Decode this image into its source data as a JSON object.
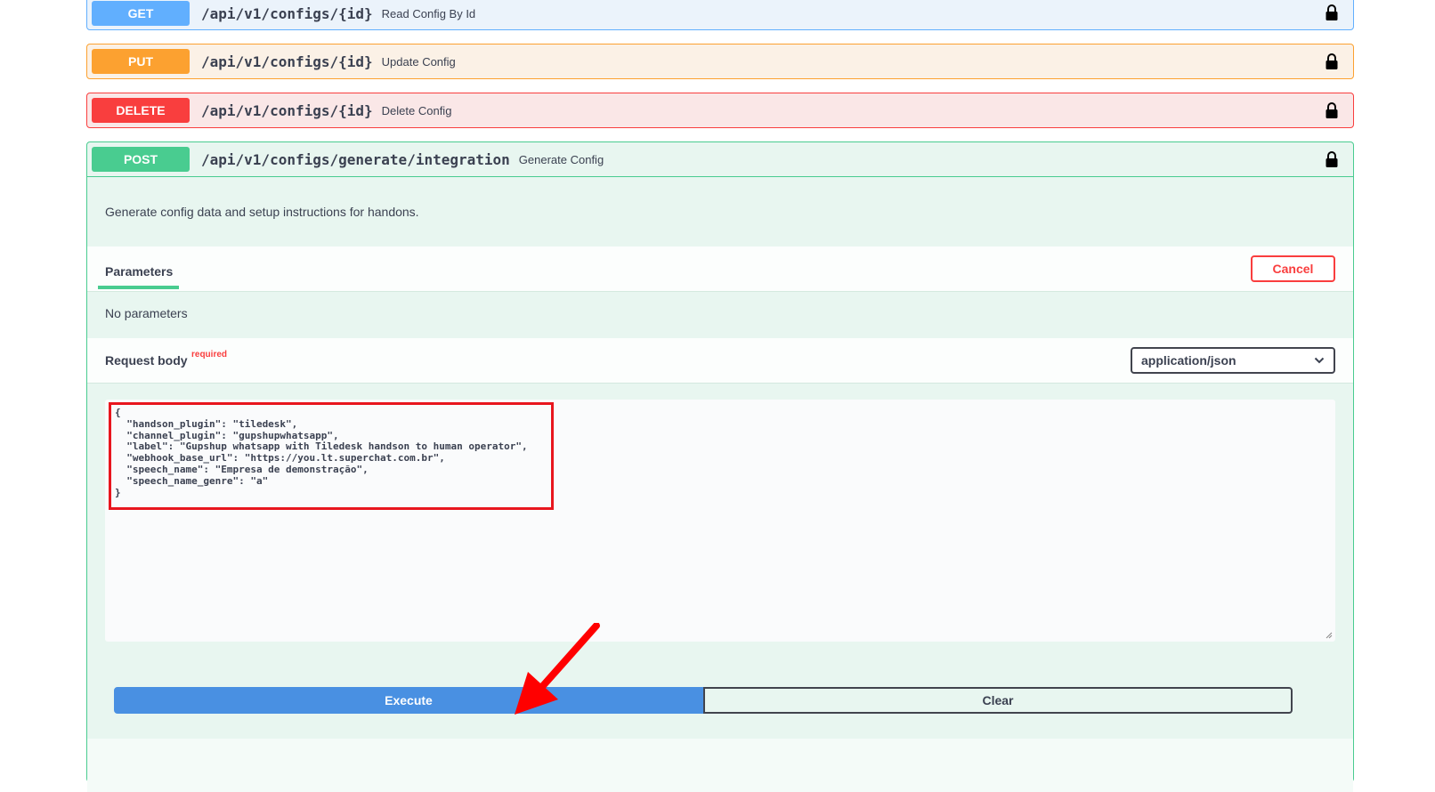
{
  "operations": {
    "get": {
      "method": "GET",
      "path": "/api/v1/configs/{id}",
      "summary": "Read Config By Id"
    },
    "put": {
      "method": "PUT",
      "path": "/api/v1/configs/{id}",
      "summary": "Update Config"
    },
    "delete": {
      "method": "DELETE",
      "path": "/api/v1/configs/{id}",
      "summary": "Delete Config"
    },
    "post": {
      "method": "POST",
      "path": "/api/v1/configs/generate/integration",
      "summary": "Generate Config",
      "description": "Generate config data and setup instructions for handons.",
      "parameters_tab": "Parameters",
      "cancel_label": "Cancel",
      "no_parameters": "No parameters",
      "request_body_label": "Request body",
      "required_label": "required",
      "content_type": "application/json",
      "request_body": "{\n  \"handson_plugin\": \"tiledesk\",\n  \"channel_plugin\": \"gupshupwhatsapp\",\n  \"label\": \"Gupshup whatsapp with Tiledesk handson to human operator\",\n  \"webhook_base_url\": \"https://you.lt.superchat.com.br\",\n  \"speech_name\": \"Empresa de demonstração\",\n  \"speech_name_genre\": \"a\"\n}",
      "execute_label": "Execute",
      "clear_label": "Clear"
    }
  },
  "colors": {
    "get": "#61affe",
    "put": "#fca130",
    "delete": "#f93e3e",
    "post": "#49cc90",
    "execute": "#4990e2",
    "annotation": "#e8161e"
  },
  "icons": {
    "lock": "lock-icon",
    "chevron": "chevron-down-icon",
    "annotation_arrow": "red-arrow-icon"
  }
}
